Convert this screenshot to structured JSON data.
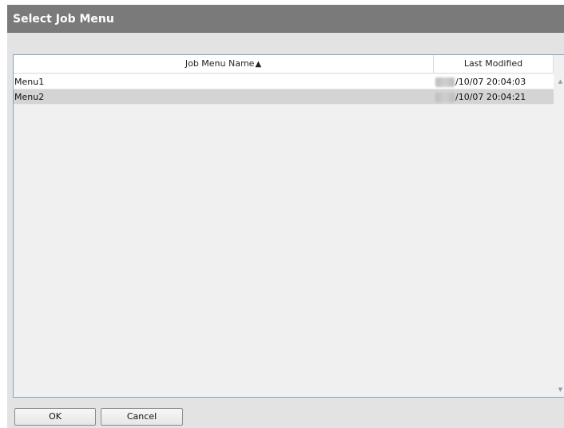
{
  "dialog": {
    "title": "Select Job Menu"
  },
  "table": {
    "columns": [
      {
        "label": "Job Menu Name",
        "sort_indicator": "▲"
      },
      {
        "label": "Last Modified"
      }
    ],
    "rows": [
      {
        "name": "Menu1",
        "modified": "/10/07 20:04:03",
        "selected": false
      },
      {
        "name": "Menu2",
        "modified": "/10/07 20:04:21",
        "selected": true
      }
    ]
  },
  "scrollbar": {
    "up_icon": "scroll-up-arrow",
    "down_icon": "scroll-down-arrow"
  },
  "buttons": {
    "ok_label": "OK",
    "cancel_label": "Cancel"
  }
}
